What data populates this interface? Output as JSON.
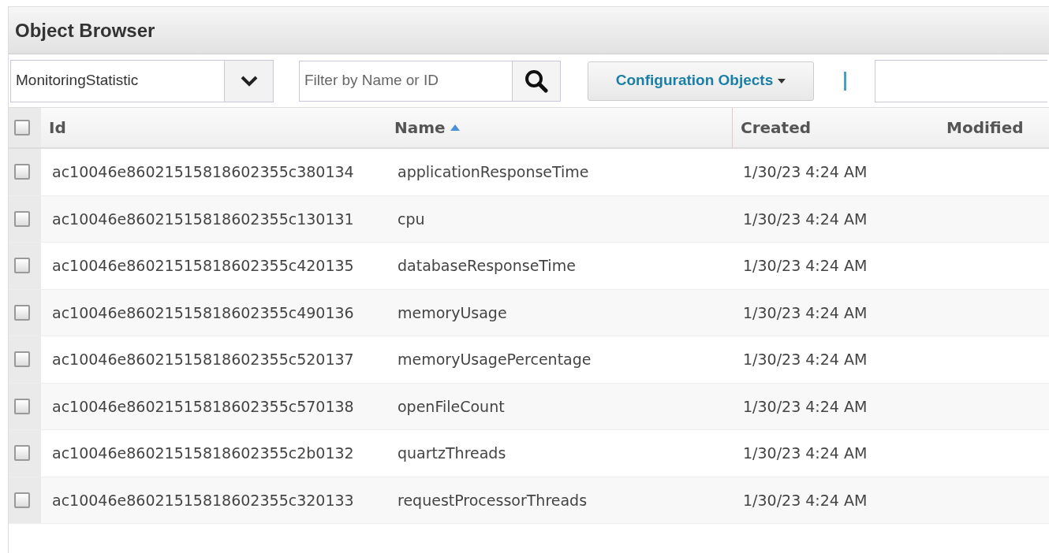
{
  "panel": {
    "title": "Object Browser"
  },
  "toolbar": {
    "type_select": {
      "value": "MonitoringStatistic"
    },
    "filter": {
      "placeholder": "Filter by Name or ID"
    },
    "menu_button": {
      "label": "Configuration Objects"
    }
  },
  "table": {
    "select_all": {
      "checked": false
    },
    "columns": [
      {
        "label": "Id",
        "sorted": false
      },
      {
        "label": "Name",
        "sorted": true
      },
      {
        "label": "Created",
        "sorted": false
      },
      {
        "label": "Modified",
        "sorted": false
      }
    ],
    "rows": [
      {
        "checked": false,
        "id": "ac10046e86021515818602355c380134",
        "name": "applicationResponseTime",
        "created": "1/30/23 4:24 AM"
      },
      {
        "checked": false,
        "id": "ac10046e86021515818602355c130131",
        "name": "cpu",
        "created": "1/30/23 4:24 AM"
      },
      {
        "checked": false,
        "id": "ac10046e86021515818602355c420135",
        "name": "databaseResponseTime",
        "created": "1/30/23 4:24 AM"
      },
      {
        "checked": false,
        "id": "ac10046e86021515818602355c490136",
        "name": "memoryUsage",
        "created": "1/30/23 4:24 AM"
      },
      {
        "checked": false,
        "id": "ac10046e86021515818602355c520137",
        "name": "memoryUsagePercentage",
        "created": "1/30/23 4:24 AM"
      },
      {
        "checked": false,
        "id": "ac10046e86021515818602355c570138",
        "name": "openFileCount",
        "created": "1/30/23 4:24 AM"
      },
      {
        "checked": false,
        "id": "ac10046e86021515818602355c2b0132",
        "name": "quartzThreads",
        "created": "1/30/23 4:24 AM"
      },
      {
        "checked": false,
        "id": "ac10046e86021515818602355c320133",
        "name": "requestProcessorThreads",
        "created": "1/30/23 4:24 AM"
      }
    ]
  }
}
